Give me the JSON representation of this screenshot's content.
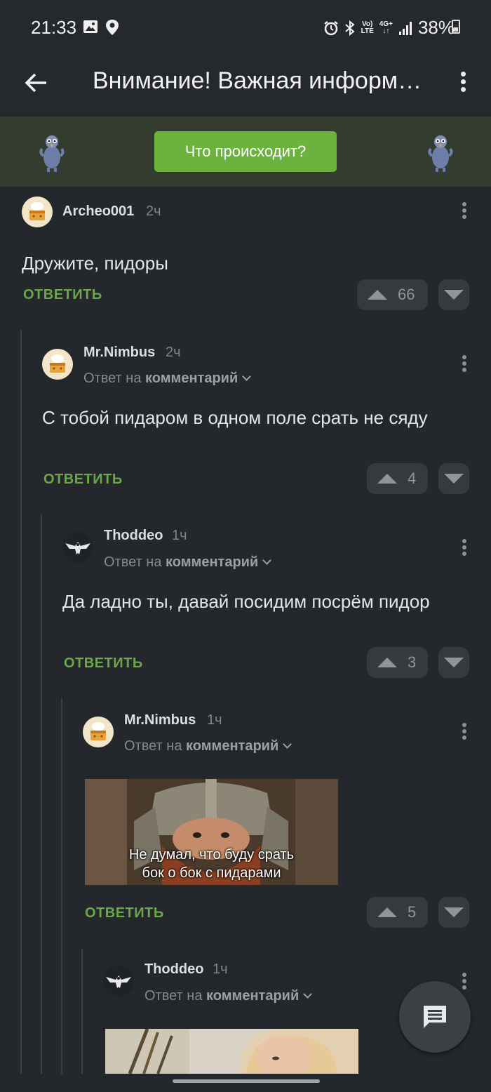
{
  "status_bar": {
    "time": "21:33",
    "network_top": "Vo)",
    "network_bottom": "LTE",
    "net_type": "4G+",
    "battery": "38%"
  },
  "app_bar": {
    "title": "Внимание! Важная информация"
  },
  "banner": {
    "button_label": "Что происходит?"
  },
  "comments": [
    {
      "author": "Archeo001",
      "time": "2ч",
      "text": "Дружите, пидоры",
      "reply_label": "ОТВЕТИТЬ",
      "votes": "66"
    },
    {
      "author": "Mr.Nimbus",
      "time": "2ч",
      "reply_to_prefix": "Ответ на",
      "reply_to_target": "комментарий",
      "text": "С тобой пидаром в одном поле срать не сяду",
      "reply_label": "ОТВЕТИТЬ",
      "votes": "4"
    },
    {
      "author": "Thoddeo",
      "time": "1ч",
      "reply_to_prefix": "Ответ на",
      "reply_to_target": "комментарий",
      "text": "Да ладно ты, давай посидим посрём пидор",
      "reply_label": "ОТВЕТИТЬ",
      "votes": "3"
    },
    {
      "author": "Mr.Nimbus",
      "time": "1ч",
      "reply_to_prefix": "Ответ на",
      "reply_to_target": "комментарий",
      "image_caption_line1": "Не думал, что буду срать",
      "image_caption_line2": "бок о бок с пидарами",
      "reply_label": "ОТВЕТИТЬ",
      "votes": "5"
    },
    {
      "author": "Thoddeo",
      "time": "1ч",
      "reply_to_prefix": "Ответ на",
      "reply_to_target": "комментарий"
    }
  ]
}
